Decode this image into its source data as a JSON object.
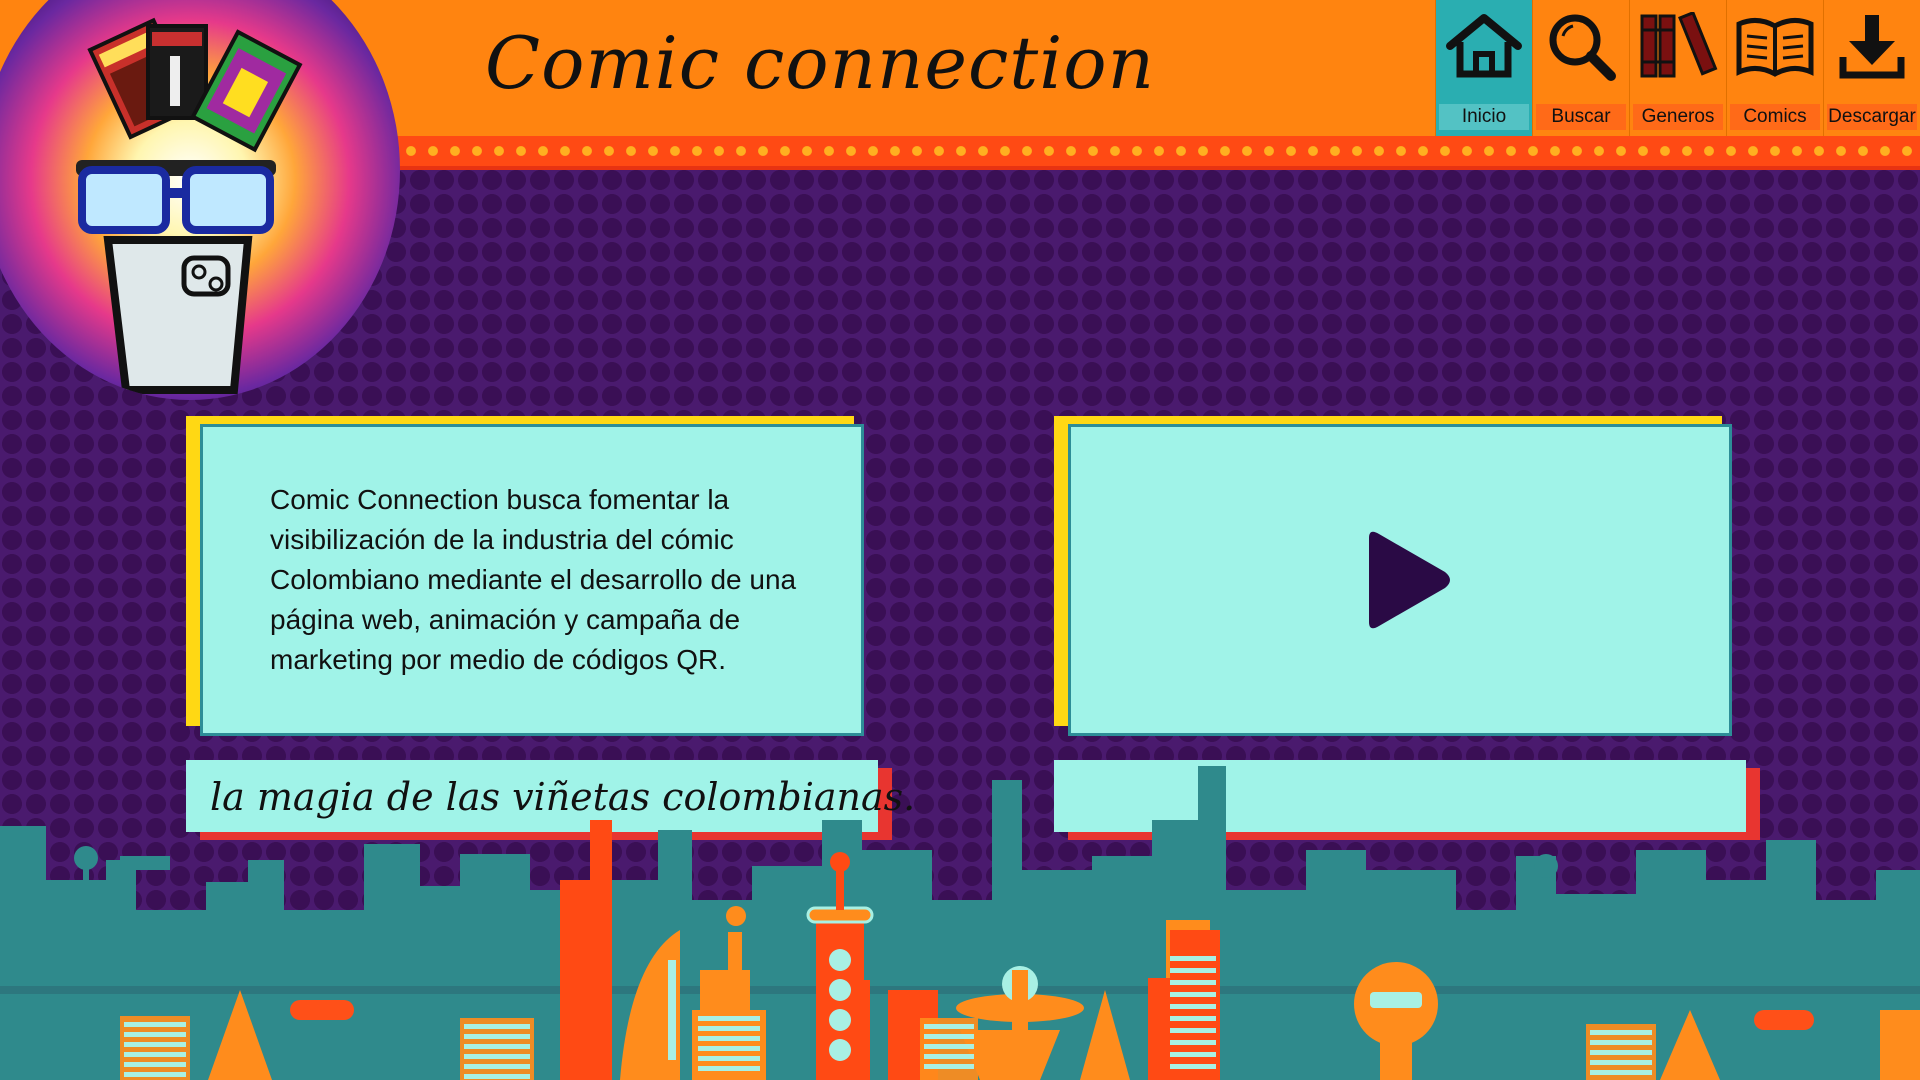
{
  "header": {
    "title": "Comic connection"
  },
  "nav": {
    "items": [
      {
        "label": "Inicio",
        "icon": "home-icon",
        "active": true
      },
      {
        "label": "Buscar",
        "icon": "search-icon",
        "active": false
      },
      {
        "label": "Generos",
        "icon": "books-icon",
        "active": false
      },
      {
        "label": "Comics",
        "icon": "open-book-icon",
        "active": false
      },
      {
        "label": "Descargar",
        "icon": "download-icon",
        "active": false
      }
    ]
  },
  "main": {
    "description": "Comic Connection busca fomentar la visibilización de la industria del cómic Colombiano mediante el desarrollo de una página web, animación y campaña de marketing por medio de códigos QR.",
    "tagline": "la magia de las viñetas colombianas.",
    "video_caption": ""
  },
  "colors": {
    "header": "#ff8410",
    "active_nav": "#2aaeb1",
    "panel": "#a0f3e8",
    "background": "#4a1a6e",
    "accent_yellow": "#ffd814",
    "accent_red": "#e83530"
  }
}
